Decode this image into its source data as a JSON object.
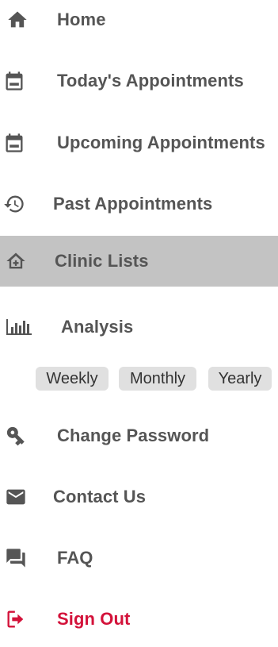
{
  "menu": {
    "items": [
      {
        "label": "Home",
        "icon": "home-icon"
      },
      {
        "label": "Today's Appointments",
        "icon": "calendar-today-icon"
      },
      {
        "label": "Upcoming Appointments",
        "icon": "calendar-upcoming-icon"
      },
      {
        "label": "Past Appointments",
        "icon": "history-icon"
      },
      {
        "label": "Clinic Lists",
        "icon": "clinic-icon",
        "active": true
      },
      {
        "label": "Analysis",
        "icon": "bar-chart-icon"
      },
      {
        "label": "Change Password",
        "icon": "key-icon"
      },
      {
        "label": "Contact Us",
        "icon": "mail-icon"
      },
      {
        "label": "FAQ",
        "icon": "forum-icon"
      },
      {
        "label": "Sign Out",
        "icon": "sign-out-icon"
      }
    ],
    "analysis_options": [
      "Weekly",
      "Monthly",
      "Yearly"
    ]
  },
  "colors": {
    "text": "#555555",
    "active_background": "#c3c3c3",
    "chip_background": "#e0e0e0",
    "sign_out": "#d3123a"
  }
}
